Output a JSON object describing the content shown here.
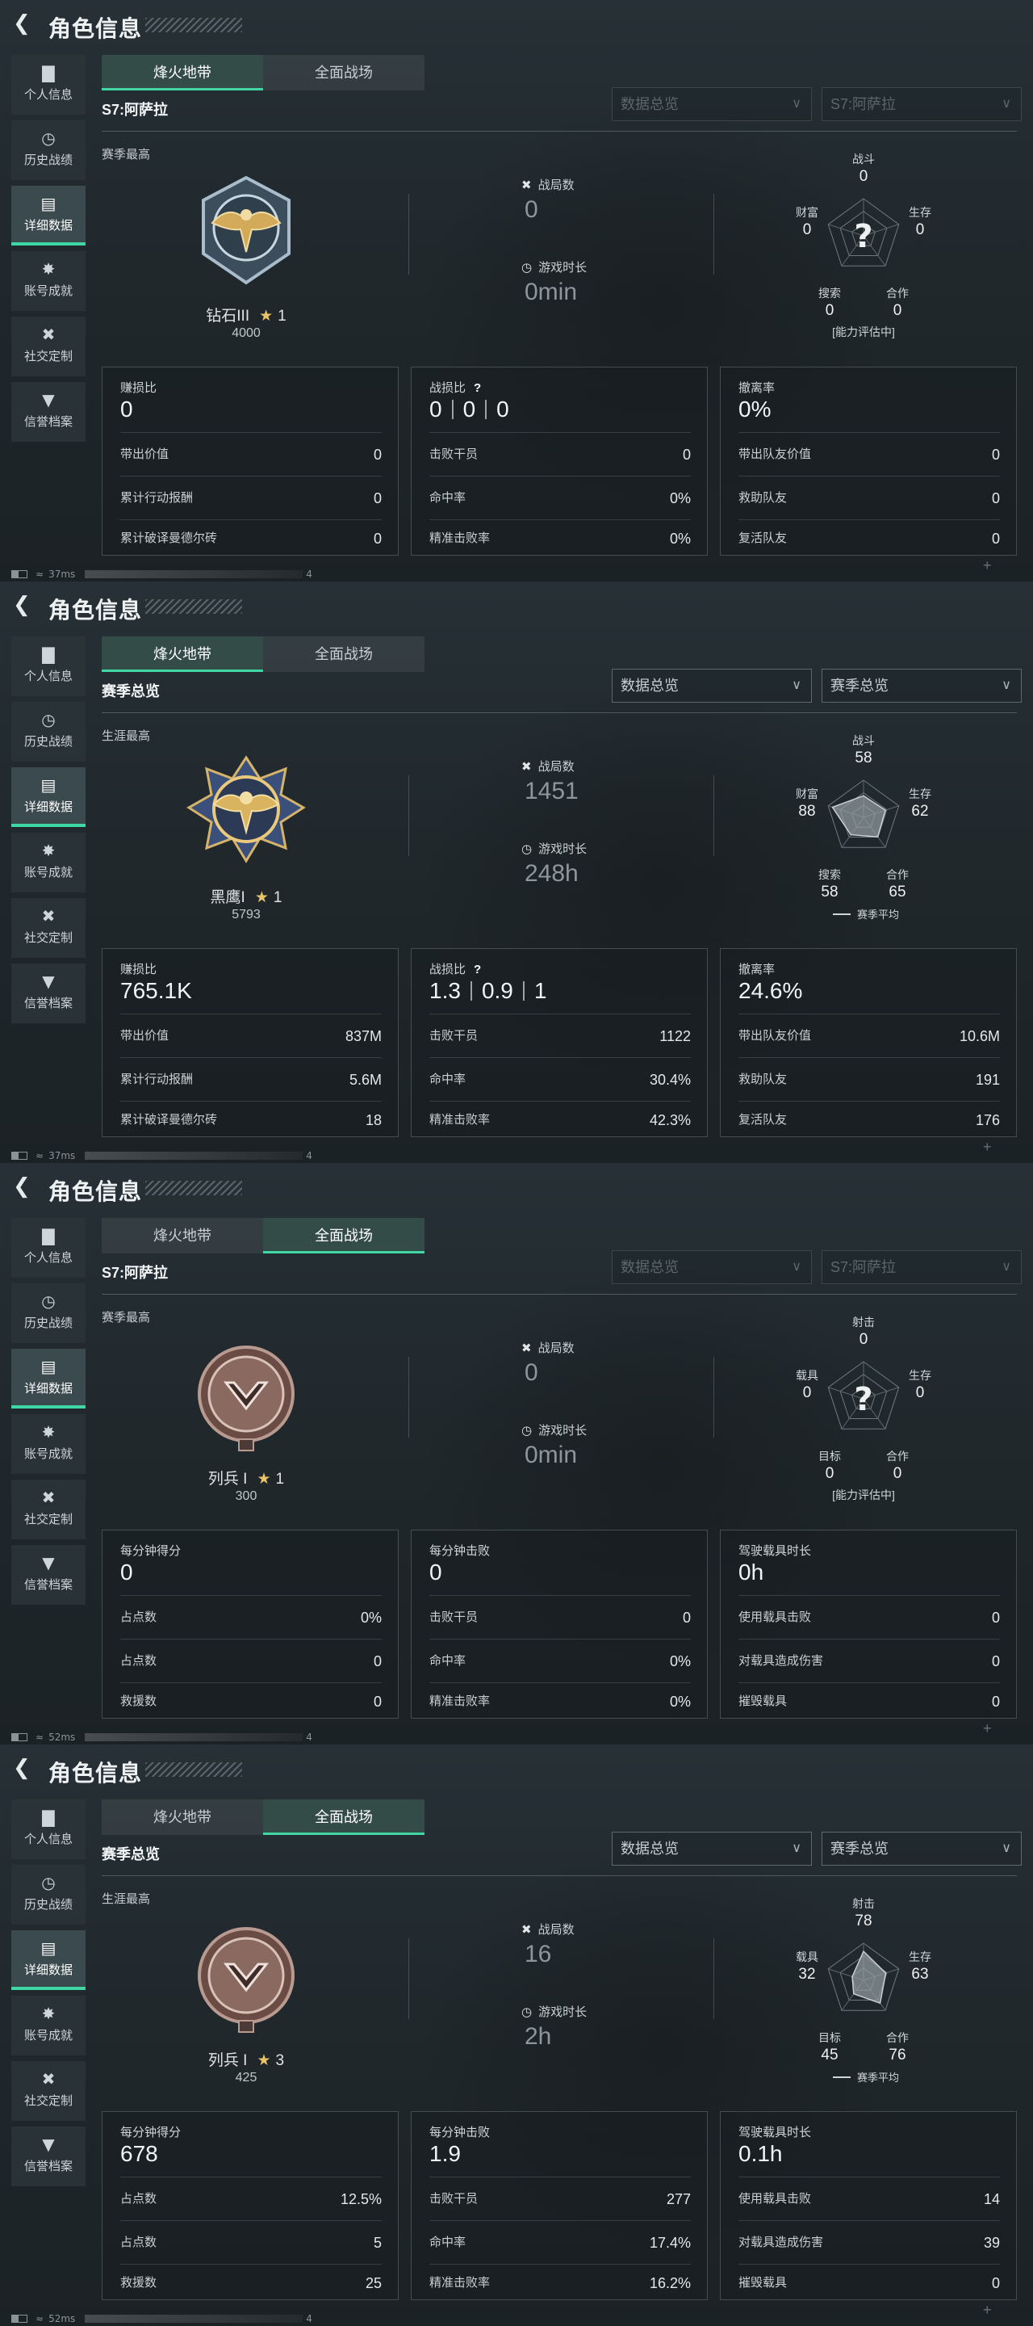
{
  "header": {
    "back_icon": "back-arrow-icon",
    "title": "角色信息"
  },
  "sidebar": {
    "items": [
      {
        "label": "个人信息",
        "icon": "bar-chart-icon"
      },
      {
        "label": "历史战绩",
        "icon": "clock-icon"
      },
      {
        "label": "详细数据",
        "icon": "folder-icon"
      },
      {
        "label": "账号成就",
        "icon": "badge-icon"
      },
      {
        "label": "社交定制",
        "icon": "wrench-icon"
      },
      {
        "label": "信誉档案",
        "icon": "shield-icon"
      }
    ],
    "active_index": 2
  },
  "tabs": [
    "烽火地带",
    "全面战场"
  ],
  "accent_color": "#3fd8a4",
  "panels": [
    {
      "active_tab": 0,
      "subtitle": "S7:阿萨拉",
      "dropdowns": [
        "数据总览",
        "S7:阿萨拉"
      ],
      "dropdowns_dim": true,
      "section_label": "赛季最高",
      "rank": {
        "name": "钻石III",
        "stars": "1",
        "score": "4000",
        "emblem": "diamond-rank-emblem"
      },
      "stats": [
        {
          "label": "战局数",
          "value": "0"
        },
        {
          "label": "游戏时长",
          "value": "0min"
        }
      ],
      "radar": {
        "labels": [
          "战斗",
          "生存",
          "合作",
          "搜索",
          "财富"
        ],
        "values": [
          "0",
          "0",
          "0",
          "0",
          "0"
        ],
        "levels": [
          0,
          0,
          0,
          0,
          0
        ],
        "evaluating": true,
        "note": "[能力评估中]"
      },
      "cards": [
        {
          "title": "赚损比",
          "value": "0",
          "rows": [
            [
              "带出价值",
              "0"
            ],
            [
              "累计行动报酬",
              "0"
            ],
            [
              "累计破译曼德尔砖",
              "0"
            ]
          ]
        },
        {
          "title": "战损比",
          "help": true,
          "values": [
            "0",
            "0",
            "0"
          ],
          "rows": [
            [
              "击败干员",
              "0"
            ],
            [
              "命中率",
              "0%"
            ],
            [
              "精准击败率",
              "0%"
            ]
          ]
        },
        {
          "title": "撤离率",
          "value": "0%",
          "rows": [
            [
              "带出队友价值",
              "0"
            ],
            [
              "救助队友",
              "0"
            ],
            [
              "复活队友",
              "0"
            ]
          ]
        }
      ],
      "status": {
        "ping": "37ms",
        "count": "4"
      }
    },
    {
      "active_tab": 0,
      "subtitle": "赛季总览",
      "dropdowns": [
        "数据总览",
        "赛季总览"
      ],
      "dropdowns_dim": false,
      "section_label": "生涯最高",
      "rank": {
        "name": "黑鹰I",
        "stars": "1",
        "score": "5793",
        "emblem": "black-hawk-rank-emblem"
      },
      "stats": [
        {
          "label": "战局数",
          "value": "1451"
        },
        {
          "label": "游戏时长",
          "value": "248h"
        }
      ],
      "radar": {
        "labels": [
          "战斗",
          "生存",
          "合作",
          "搜索",
          "财富"
        ],
        "values": [
          "58",
          "62",
          "65",
          "58",
          "88"
        ],
        "levels": [
          0.58,
          0.62,
          0.65,
          0.58,
          0.88
        ],
        "evaluating": false,
        "note": "赛季平均"
      },
      "cards": [
        {
          "title": "赚损比",
          "value": "765.1K",
          "rows": [
            [
              "带出价值",
              "837M"
            ],
            [
              "累计行动报酬",
              "5.6M"
            ],
            [
              "累计破译曼德尔砖",
              "18"
            ]
          ]
        },
        {
          "title": "战损比",
          "help": true,
          "values": [
            "1.3",
            "0.9",
            "1"
          ],
          "rows": [
            [
              "击败干员",
              "1122"
            ],
            [
              "命中率",
              "30.4%"
            ],
            [
              "精准击败率",
              "42.3%"
            ]
          ]
        },
        {
          "title": "撤离率",
          "value": "24.6%",
          "rows": [
            [
              "带出队友价值",
              "10.6M"
            ],
            [
              "救助队友",
              "191"
            ],
            [
              "复活队友",
              "176"
            ]
          ]
        }
      ],
      "status": {
        "ping": "37ms",
        "count": "4"
      }
    },
    {
      "active_tab": 1,
      "subtitle": "S7:阿萨拉",
      "dropdowns": [
        "数据总览",
        "S7:阿萨拉"
      ],
      "dropdowns_dim": true,
      "section_label": "赛季最高",
      "rank": {
        "name": "列兵 I",
        "stars": "1",
        "score": "300",
        "emblem": "private-rank-emblem"
      },
      "stats": [
        {
          "label": "战局数",
          "value": "0"
        },
        {
          "label": "游戏时长",
          "value": "0min"
        }
      ],
      "radar": {
        "labels": [
          "射击",
          "生存",
          "合作",
          "目标",
          "载具"
        ],
        "values": [
          "0",
          "0",
          "0",
          "0",
          "0"
        ],
        "levels": [
          0,
          0,
          0,
          0,
          0
        ],
        "evaluating": true,
        "note": "[能力评估中]"
      },
      "cards": [
        {
          "title": "每分钟得分",
          "value": "0",
          "rows": [
            [
              "占点数",
              "0%"
            ],
            [
              "占点数",
              "0"
            ],
            [
              "救援数",
              "0"
            ]
          ]
        },
        {
          "title": "每分钟击败",
          "value": "0",
          "rows": [
            [
              "击败干员",
              "0"
            ],
            [
              "命中率",
              "0%"
            ],
            [
              "精准击败率",
              "0%"
            ]
          ]
        },
        {
          "title": "驾驶载具时长",
          "value": "0h",
          "rows": [
            [
              "使用载具击败",
              "0"
            ],
            [
              "对载具造成伤害",
              "0"
            ],
            [
              "摧毁载具",
              "0"
            ]
          ]
        }
      ],
      "status": {
        "ping": "52ms",
        "count": "4"
      }
    },
    {
      "active_tab": 1,
      "subtitle": "赛季总览",
      "dropdowns": [
        "数据总览",
        "赛季总览"
      ],
      "dropdowns_dim": false,
      "section_label": "生涯最高",
      "rank": {
        "name": "列兵 I",
        "stars": "3",
        "score": "425",
        "emblem": "private-rank-emblem"
      },
      "stats": [
        {
          "label": "战局数",
          "value": "16"
        },
        {
          "label": "游戏时长",
          "value": "2h"
        }
      ],
      "radar": {
        "labels": [
          "射击",
          "生存",
          "合作",
          "目标",
          "载具"
        ],
        "values": [
          "78",
          "63",
          "76",
          "45",
          "32"
        ],
        "levels": [
          0.78,
          0.63,
          0.76,
          0.45,
          0.32
        ],
        "evaluating": false,
        "note": "赛季平均"
      },
      "cards": [
        {
          "title": "每分钟得分",
          "value": "678",
          "rows": [
            [
              "占点数",
              "12.5%"
            ],
            [
              "占点数",
              "5"
            ],
            [
              "救援数",
              "25"
            ]
          ]
        },
        {
          "title": "每分钟击败",
          "value": "1.9",
          "rows": [
            [
              "击败干员",
              "277"
            ],
            [
              "命中率",
              "17.4%"
            ],
            [
              "精准击败率",
              "16.2%"
            ]
          ]
        },
        {
          "title": "驾驶载具时长",
          "value": "0.1h",
          "rows": [
            [
              "使用载具击败",
              "14"
            ],
            [
              "对载具造成伤害",
              "39"
            ],
            [
              "摧毁载具",
              "0"
            ]
          ]
        }
      ],
      "status": {
        "ping": "52ms",
        "count": "4"
      }
    }
  ]
}
